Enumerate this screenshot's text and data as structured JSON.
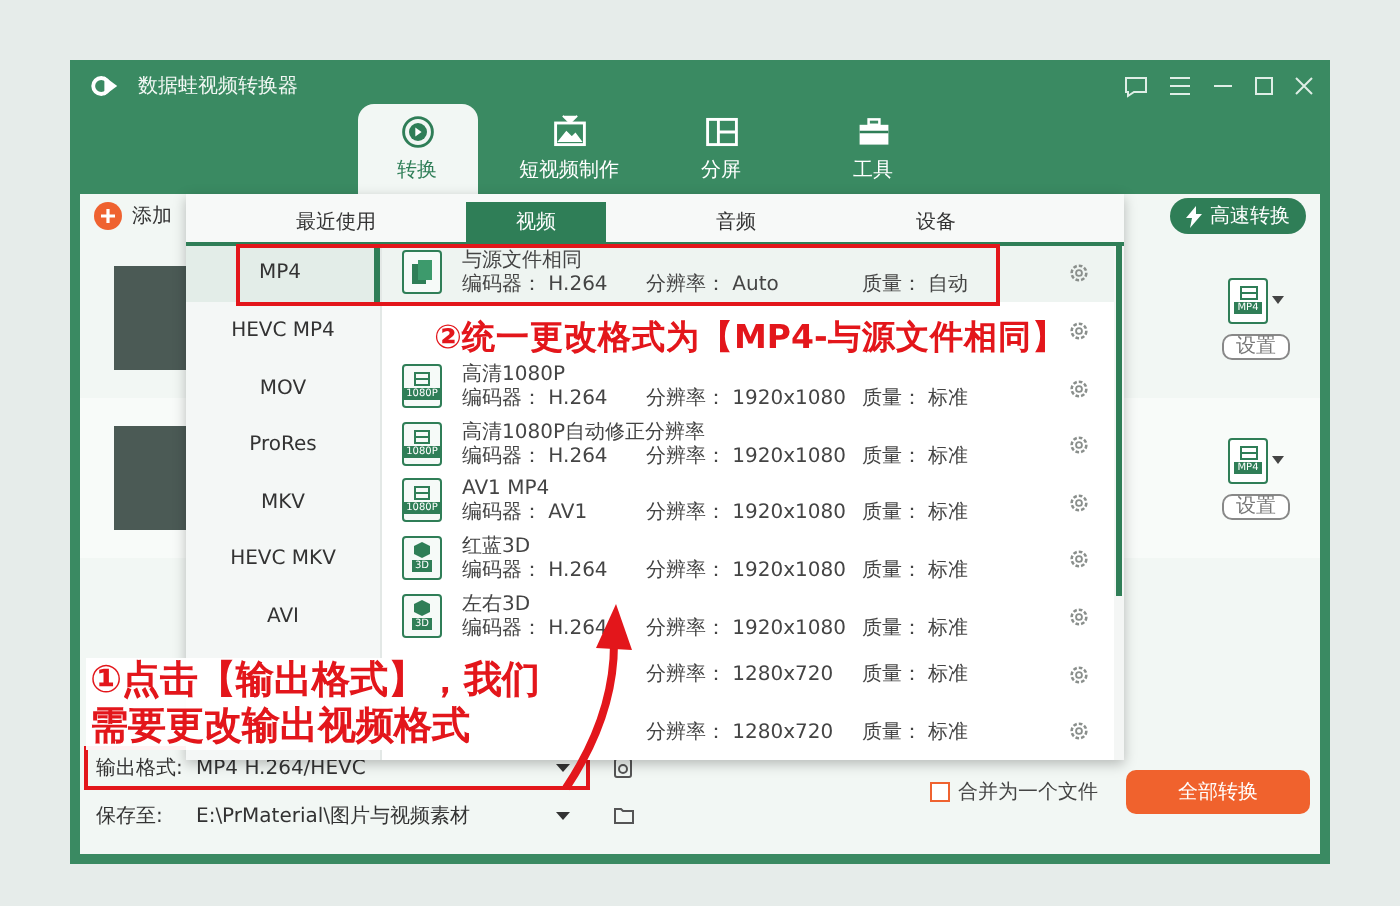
{
  "window": {
    "title": "数据蛙视频转换器"
  },
  "main_tabs": [
    {
      "label": "转换",
      "kind": "convert",
      "selected": true
    },
    {
      "label": "短视频制作",
      "kind": "tv",
      "selected": false
    },
    {
      "label": "分屏",
      "kind": "split",
      "selected": false
    },
    {
      "label": "工具",
      "kind": "toolbox",
      "selected": false
    }
  ],
  "toolbar": {
    "add_files": "添加",
    "fast_convert": "高速转换"
  },
  "files": [
    {
      "format_badge": "MP4",
      "settings": "设置"
    },
    {
      "format_badge": "MP4",
      "settings": "设置"
    }
  ],
  "format_popup": {
    "tabs": [
      {
        "label": "最近使用",
        "selected": false
      },
      {
        "label": "视频",
        "selected": true
      },
      {
        "label": "音频",
        "selected": false
      },
      {
        "label": "设备",
        "selected": false
      }
    ],
    "formats": [
      {
        "label": "MP4",
        "selected": true
      },
      {
        "label": "HEVC MP4",
        "selected": false
      },
      {
        "label": "MOV",
        "selected": false
      },
      {
        "label": "ProRes",
        "selected": false
      },
      {
        "label": "MKV",
        "selected": false
      },
      {
        "label": "HEVC MKV",
        "selected": false
      },
      {
        "label": "AVI",
        "selected": false
      }
    ],
    "presets": [
      {
        "kind": "source",
        "name": "与源文件相同",
        "encoder": "编码器：  H.264",
        "resolution": "分辨率：  Auto",
        "quality": "质量：  自动",
        "selected": true
      },
      {
        "kind": "hidden",
        "selected": false
      },
      {
        "kind": "film",
        "badge": "1080P",
        "name": "高清1080P",
        "encoder": "编码器：  H.264",
        "resolution": "分辨率：  1920x1080",
        "quality": "质量：  标准",
        "selected": false
      },
      {
        "kind": "film",
        "badge": "1080P",
        "name": "高清1080P自动修正分辨率",
        "encoder": "编码器：  H.264",
        "resolution": "分辨率：  1920x1080",
        "quality": "质量：  标准",
        "selected": false
      },
      {
        "kind": "film",
        "badge": "1080P",
        "name": "AV1 MP4",
        "encoder": "编码器：  AV1",
        "resolution": "分辨率：  1920x1080",
        "quality": "质量：  标准",
        "selected": false
      },
      {
        "kind": "cube",
        "badge": "3D",
        "name": "红蓝3D",
        "encoder": "编码器：  H.264",
        "resolution": "分辨率：  1920x1080",
        "quality": "质量：  标准",
        "selected": false
      },
      {
        "kind": "cube",
        "badge": "3D",
        "name": "左右3D",
        "encoder": "编码器：  H.264",
        "resolution": "分辨率：  1920x1080",
        "quality": "质量：  标准",
        "selected": false
      },
      {
        "kind": "hidden",
        "resolution": "分辨率：  1280x720",
        "quality": "质量：  标准",
        "selected": false
      },
      {
        "kind": "hidden",
        "resolution": "分辨率：  1280x720",
        "quality": "质量：  标准",
        "selected": false
      }
    ]
  },
  "annotations": [
    {
      "kind": "row-box"
    },
    {
      "kind": "step-2",
      "text": "②统一更改格式为【MP4-与源文件相同】"
    },
    {
      "kind": "step-1",
      "text": "①点击【输出格式】，我们需要更改输出视频格式"
    },
    {
      "kind": "arrow"
    }
  ],
  "output_format": {
    "label": "输出格式:",
    "value": "MP4 H.264/HEVC",
    "highlighted": true
  },
  "save_to": {
    "label": "保存至:",
    "value": "E:\\PrMaterial\\图片与视频素材"
  },
  "merge": {
    "label": "合并为一个文件",
    "checked": false
  },
  "convert_all": "全部转换"
}
